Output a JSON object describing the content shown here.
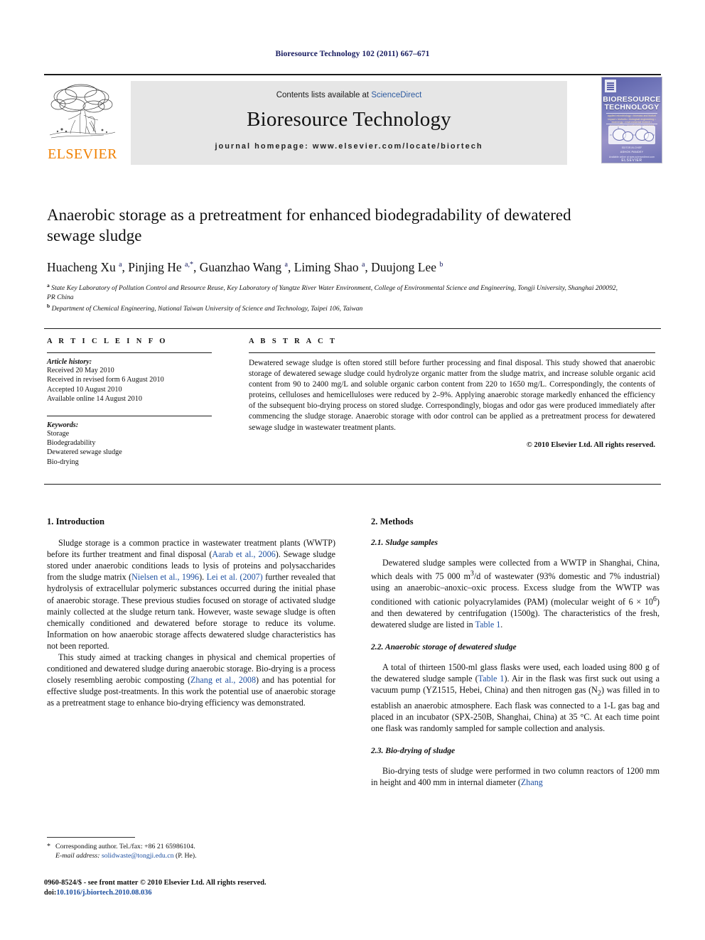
{
  "running_head": "Bioresource Technology 102 (2011) 667–671",
  "masthead": {
    "elsevier_wordmark": "ELSEVIER",
    "contents_prefix": "Contents lists available at ",
    "sciencedirect": "ScienceDirect",
    "journal_title": "Bioresource Technology",
    "homepage": "journal homepage: www.elsevier.com/locate/biortech",
    "cover": {
      "title_line1": "BIORESOURCE",
      "title_line2": "TECHNOLOGY",
      "subtitle": "applied microbiology • biomass and biofuel impact • biofuels • biological engineering • bioenergy • environmental biotech • bioprocesses • biorefineries • biobased",
      "editor_note": "EDITOR-IN-CHIEF",
      "editor_name": "ASHOK PANDEY",
      "available_note": "Available online at www.sciencedirect.com",
      "publisher": "ELSEVIER"
    },
    "accent_link_color": "#2c5aa0",
    "band_color": "#e6e6e6"
  },
  "article": {
    "title": "Anaerobic storage as a pretreatment for enhanced biodegradability of dewatered sewage sludge",
    "authors_html": "Huacheng Xu <sup>a</sup>, Pinjing He <sup>a,*</sup>, Guanzhao Wang <sup>a</sup>, Liming Shao <sup>a</sup>, Duujong Lee <sup>b</sup>",
    "affiliation_a": "State Key Laboratory of Pollution Control and Resource Reuse, Key Laboratory of Yangtze River Water Environment, College of Environmental Science and Engineering, Tongji University, Shanghai 200092, PR China",
    "affiliation_b": "Department of Chemical Engineering, National Taiwan University of Science and Technology, Taipei 106, Taiwan"
  },
  "article_info": {
    "section_label": "A R T I C L E   I N F O",
    "history_label": "Article history:",
    "history": [
      "Received 20 May 2010",
      "Received in revised form 6 August 2010",
      "Accepted 10 August 2010",
      "Available online 14 August 2010"
    ],
    "keywords_label": "Keywords:",
    "keywords": [
      "Storage",
      "Biodegradability",
      "Dewatered sewage sludge",
      "Bio-drying"
    ]
  },
  "abstract": {
    "section_label": "A B S T R A C T",
    "text": "Dewatered sewage sludge is often stored still before further processing and final disposal. This study showed that anaerobic storage of dewatered sewage sludge could hydrolyze organic matter from the sludge matrix, and increase soluble organic acid content from 90 to 2400 mg/L and soluble organic carbon content from 220 to 1650 mg/L. Correspondingly, the contents of proteins, celluloses and hemicelluloses were reduced by 2–9%. Applying anaerobic storage markedly enhanced the efficiency of the subsequent bio-drying process on stored sludge. Correspondingly, biogas and odor gas were produced immediately after commencing the sludge storage. Anaerobic storage with odor control can be applied as a pretreatment process for dewatered sewage sludge in wastewater treatment plants.",
    "copyright": "© 2010 Elsevier Ltd. All rights reserved."
  },
  "body": {
    "left": {
      "heading": "1. Introduction",
      "p1_a": "Sludge storage is a common practice in wastewater treatment plants (WWTP) before its further treatment and final disposal (",
      "p1_cite1": "Aarab et al., 2006",
      "p1_b": "). Sewage sludge stored under anaerobic conditions leads to lysis of proteins and polysaccharides from the sludge matrix (",
      "p1_cite2": "Nielsen et al., 1996",
      "p1_c": "). ",
      "p1_cite3": "Lei et al. (2007)",
      "p1_d": " further revealed that hydrolysis of extracellular polymeric substances occurred during the initial phase of anaerobic storage. These previous studies focused on storage of activated sludge mainly collected at the sludge return tank. However, waste sewage sludge is often chemically conditioned and dewatered before storage to reduce its volume. Information on how anaerobic storage affects dewatered sludge characteristics has not been reported.",
      "p2_a": "This study aimed at tracking changes in physical and chemical properties of conditioned and dewatered sludge during anaerobic storage. Bio-drying is a process closely resembling aerobic composting (",
      "p2_cite1": "Zhang et al., 2008",
      "p2_b": ") and has potential for effective sludge post-treatments. In this work the potential use of anaerobic storage as a pretreatment stage to enhance bio-drying efficiency was demonstrated."
    },
    "right": {
      "heading": "2. Methods",
      "sub1": "2.1. Sludge samples",
      "sub1_p_a": "Dewatered sludge samples were collected from a WWTP in Shanghai, China, which deals with 75 000 m",
      "sub1_p_b": "/d of wastewater (93% domestic and 7% industrial) using an anaerobic–anoxic–oxic process. Excess sludge from the WWTP was conditioned with cationic polyacrylamides (PAM) (molecular weight of 6 × 10",
      "sub1_p_c": ") and then dewatered by centrifugation (1500g). The characteristics of the fresh, dewatered sludge are listed in ",
      "sub1_cite": "Table 1",
      "sub1_p_d": ".",
      "sub2": "2.2. Anaerobic storage of dewatered sludge",
      "sub2_p_a": "A total of thirteen 1500-ml glass flasks were used, each loaded using 800 g of the dewatered sludge sample (",
      "sub2_cite": "Table 1",
      "sub2_p_b": "). Air in the flask was first suck out using a vacuum pump (YZ1515, Hebei, China) and then nitrogen gas (N",
      "sub2_p_c": ") was filled in to establish an anaerobic atmosphere. Each flask was connected to a 1-L gas bag and placed in an incubator (SPX-250B, Shanghai, China) at 35 °C. At each time point one flask was randomly sampled for sample collection and analysis.",
      "sub3": "2.3. Bio-drying of sludge",
      "sub3_p_a": "Bio-drying tests of sludge were performed in two column reactors of 1200 mm in height and 400 mm in internal diameter (",
      "sub3_cite": "Zhang"
    }
  },
  "footnote": {
    "star": "*",
    "corresponding": "Corresponding author. Tel./fax: +86 21 65986104.",
    "email_label": "E-mail address:",
    "email": "solidwaste@tongji.edu.cn",
    "email_suffix": "(P. He)."
  },
  "footer": {
    "issn_line": "0960-8524/$ - see front matter © 2010 Elsevier Ltd. All rights reserved.",
    "doi_prefix": "doi:",
    "doi": "10.1016/j.biortech.2010.08.036"
  }
}
